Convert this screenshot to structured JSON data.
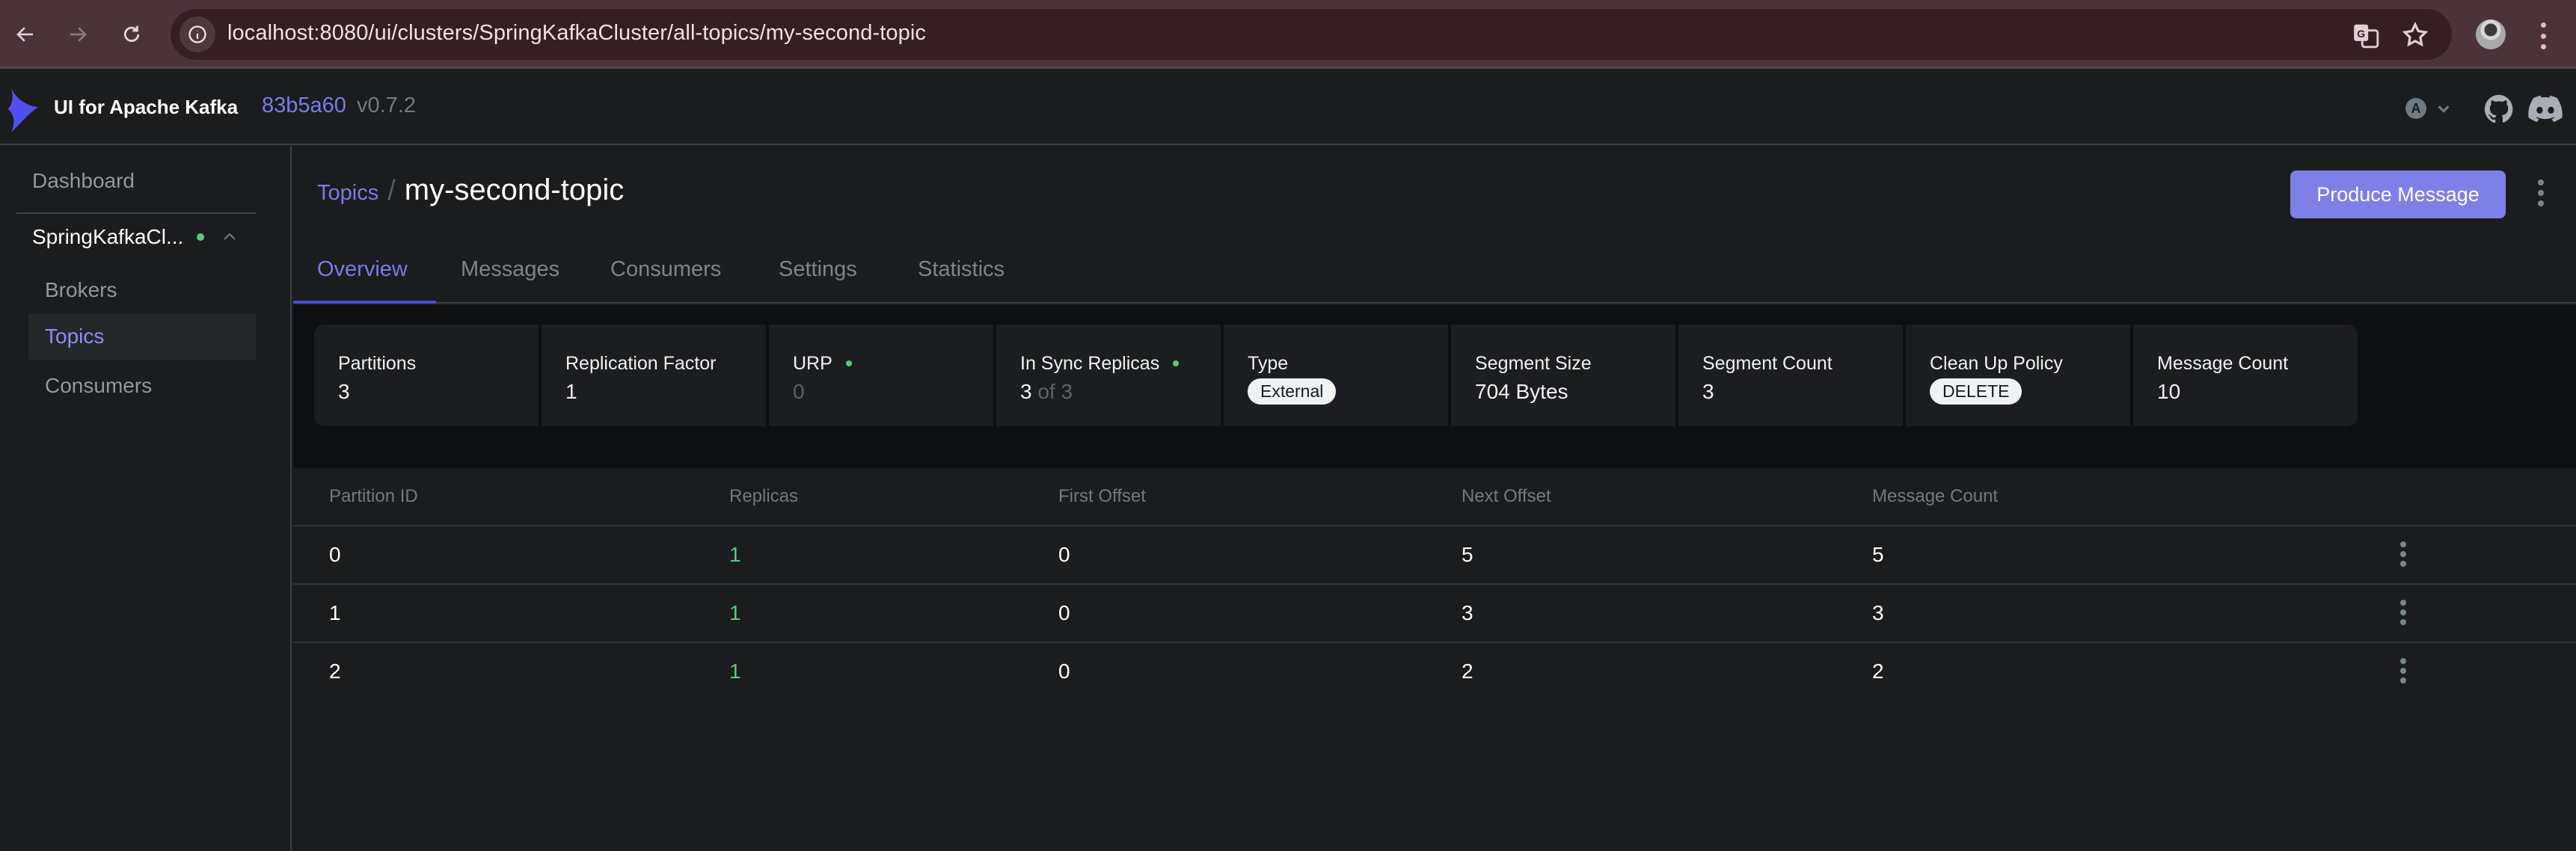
{
  "browser": {
    "url": "localhost:8080/ui/clusters/SpringKafkaCluster/all-topics/my-second-topic",
    "icons": [
      "back-arrow-icon",
      "forward-arrow-icon",
      "reload-icon",
      "site-info-icon",
      "translate-icon",
      "star-icon",
      "profile-avatar",
      "kebab-menu-icon"
    ]
  },
  "header": {
    "app_title": "UI for Apache Kafka",
    "commit": "83b5a60",
    "version": "v0.7.2",
    "theme_initial": "A",
    "colors": {
      "accent": "#7b7be8",
      "button": "#7f7fe8",
      "status_ok": "#5ec77d"
    }
  },
  "sidebar": {
    "dashboard": "Dashboard",
    "cluster_name": "SpringKafkaCl...",
    "cluster_status": "online",
    "items": [
      {
        "label": "Brokers",
        "active": false
      },
      {
        "label": "Topics",
        "active": true
      },
      {
        "label": "Consumers",
        "active": false
      }
    ]
  },
  "main": {
    "breadcrumb_parent": "Topics",
    "topic_name": "my-second-topic",
    "produce_button": "Produce Message",
    "tabs": [
      {
        "label": "Overview",
        "active": true
      },
      {
        "label": "Messages",
        "active": false
      },
      {
        "label": "Consumers",
        "active": false
      },
      {
        "label": "Settings",
        "active": false
      },
      {
        "label": "Statistics",
        "active": false
      }
    ],
    "metrics": {
      "partitions": {
        "label": "Partitions",
        "value": "3"
      },
      "replication_factor": {
        "label": "Replication Factor",
        "value": "1"
      },
      "urp": {
        "label": "URP",
        "value": "0"
      },
      "in_sync_replicas": {
        "label": "In Sync Replicas",
        "value": "3",
        "of_text": "of 3"
      },
      "type": {
        "label": "Type",
        "value": "External"
      },
      "segment_size": {
        "label": "Segment Size",
        "value": "704 Bytes"
      },
      "segment_count": {
        "label": "Segment Count",
        "value": "3"
      },
      "clean_up_policy": {
        "label": "Clean Up Policy",
        "value": "DELETE"
      },
      "message_count": {
        "label": "Message Count",
        "value": "10"
      }
    },
    "table": {
      "headers": [
        "Partition ID",
        "Replicas",
        "First Offset",
        "Next Offset",
        "Message Count"
      ],
      "rows": [
        {
          "partition": "0",
          "replicas": "1",
          "first_offset": "0",
          "next_offset": "5",
          "message_count": "5"
        },
        {
          "partition": "1",
          "replicas": "1",
          "first_offset": "0",
          "next_offset": "3",
          "message_count": "3"
        },
        {
          "partition": "2",
          "replicas": "1",
          "first_offset": "0",
          "next_offset": "2",
          "message_count": "2"
        }
      ]
    }
  }
}
